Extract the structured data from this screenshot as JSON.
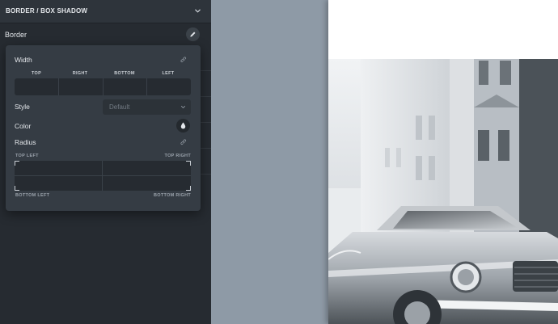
{
  "section": {
    "title": "BORDER / BOX SHADOW",
    "chevron_icon": "chevron-down-icon"
  },
  "border": {
    "label": "Border",
    "edit_icon": "pencil-icon"
  },
  "popup": {
    "width_label": "Width",
    "link_icon": "link-icon",
    "columns": [
      "TOP",
      "RIGHT",
      "BOTTOM",
      "LEFT"
    ],
    "style_label": "Style",
    "style_value": "Default",
    "color_label": "Color",
    "color_icon": "droplet-icon",
    "radius_label": "Radius",
    "corners": {
      "top_left": "TOP LEFT",
      "top_right": "TOP RIGHT",
      "bottom_left": "BOTTOM LEFT",
      "bottom_right": "BOTTOM RIGHT"
    }
  },
  "colors": {
    "panel_bg": "#262b31",
    "popup_bg": "#353c44",
    "input_bg": "#262b31",
    "canvas_gray": "#8e9aa6",
    "text": "#e3e6ea"
  },
  "preview": {
    "image_subject": "car-photo"
  }
}
